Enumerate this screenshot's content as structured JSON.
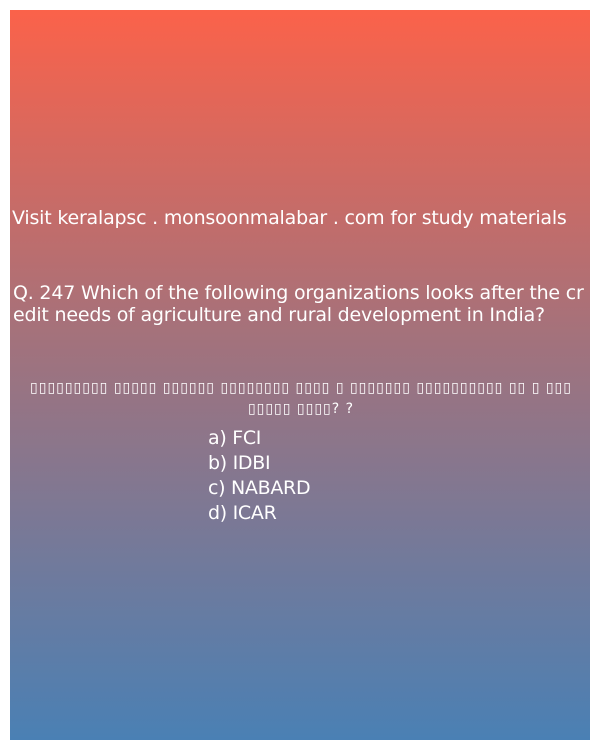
{
  "site_line": "Visit keralapsc . monsoonmalabar . com for study materials",
  "question": "Q. 247 Which of the following organizations looks after the credit needs of agriculture and rural development in India?",
  "malayalam_line": "▯▯▯▯▯▯▯▯▯ ▯▯▯▯▯ ▯▯▯▯▯▯ ▯▯▯▯▯▯▯▯ ▯▯▯▯ ▯ ▯▯▯▯▯▯▯ ▯▯▯▯▯▯▯▯▯▯ ▯▯ ▯ ▯▯▯ ▯▯▯▯▯ ▯▯▯▯?     ?",
  "options": [
    "a) FCI",
    "b) IDBI",
    "c) NABARD",
    "d) ICAR"
  ],
  "colors": {
    "gradient_top": "#fb624a",
    "gradient_bottom": "#4a80b4",
    "text": "#ffffff"
  }
}
